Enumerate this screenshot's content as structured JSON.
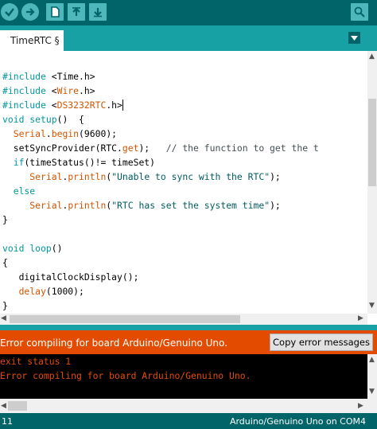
{
  "toolbar": {
    "buttons": [
      "verify-button",
      "upload-button",
      "new-button",
      "open-button",
      "save-button"
    ],
    "serial_monitor": "serial-monitor-button"
  },
  "tabs": [
    {
      "label": "TimeRTC §"
    }
  ],
  "code": [
    "",
    "#include <Time.h>",
    "#include <Wire.h>",
    "#include <DS3232RTC.h>",
    "void setup()  {",
    "  Serial.begin(9600);",
    "  setSyncProvider(RTC.get);   // the function to get the t",
    "  if(timeStatus()!= timeSet)",
    "     Serial.println(\"Unable to sync with the RTC\");",
    "  else",
    "     Serial.println(\"RTC has set the system time\");",
    "}",
    "",
    "void loop()",
    "{",
    "   digitalClockDisplay();",
    "   delay(1000);",
    "}"
  ],
  "error_bar": {
    "message": "Error compiling for board Arduino/Genuino Uno.",
    "copy_button": "Copy error messages"
  },
  "console": [
    "exit status 1",
    "Error compiling for board Arduino/Genuino Uno."
  ],
  "status": {
    "line": "11",
    "board": "Arduino/Genuino Uno on COM4"
  },
  "colors": {
    "toolbar": "#006468",
    "tabbar": "#17a1a5",
    "error": "#e34c00",
    "keyword": "#00979c",
    "function": "#d35400"
  }
}
